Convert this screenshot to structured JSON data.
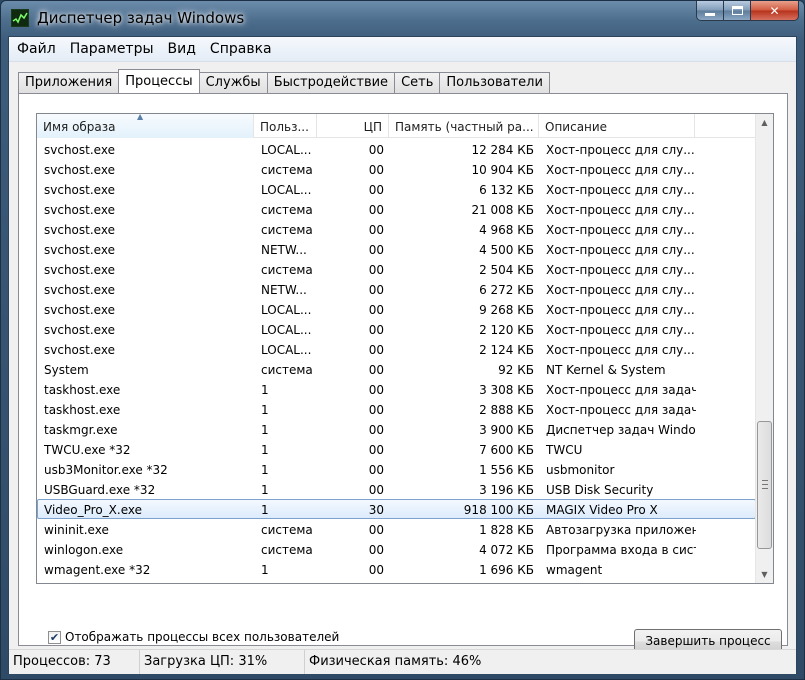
{
  "window": {
    "title": "Диспетчер задач Windows"
  },
  "menu": [
    "Файл",
    "Параметры",
    "Вид",
    "Справка"
  ],
  "tabs": [
    "Приложения",
    "Процессы",
    "Службы",
    "Быстродействие",
    "Сеть",
    "Пользователи"
  ],
  "active_tab": "Процессы",
  "table": {
    "columns": [
      "Имя образа",
      "Польз...",
      "ЦП",
      "Память (частный ра...",
      "Описание"
    ],
    "sorted_column": "Имя образа",
    "rows": [
      [
        "svchost.exe",
        "LOCAL...",
        "00",
        "12 284 КБ",
        "Хост-процесс для слу..."
      ],
      [
        "svchost.exe",
        "система",
        "00",
        "10 904 КБ",
        "Хост-процесс для слу..."
      ],
      [
        "svchost.exe",
        "LOCAL...",
        "00",
        "6 132 КБ",
        "Хост-процесс для слу..."
      ],
      [
        "svchost.exe",
        "система",
        "00",
        "21 008 КБ",
        "Хост-процесс для слу..."
      ],
      [
        "svchost.exe",
        "система",
        "00",
        "4 968 КБ",
        "Хост-процесс для слу..."
      ],
      [
        "svchost.exe",
        "NETW...",
        "00",
        "4 500 КБ",
        "Хост-процесс для слу..."
      ],
      [
        "svchost.exe",
        "система",
        "00",
        "2 504 КБ",
        "Хост-процесс для слу..."
      ],
      [
        "svchost.exe",
        "NETW...",
        "00",
        "6 272 КБ",
        "Хост-процесс для слу..."
      ],
      [
        "svchost.exe",
        "LOCAL...",
        "00",
        "9 268 КБ",
        "Хост-процесс для слу..."
      ],
      [
        "svchost.exe",
        "LOCAL...",
        "00",
        "2 120 КБ",
        "Хост-процесс для слу..."
      ],
      [
        "svchost.exe",
        "LOCAL...",
        "00",
        "2 124 КБ",
        "Хост-процесс для слу..."
      ],
      [
        "System",
        "система",
        "00",
        "92 КБ",
        "NT Kernel & System"
      ],
      [
        "taskhost.exe",
        "1",
        "00",
        "3 308 КБ",
        "Хост-процесс для задач..."
      ],
      [
        "taskhost.exe",
        "1",
        "00",
        "2 888 КБ",
        "Хост-процесс для задач..."
      ],
      [
        "taskmgr.exe",
        "1",
        "00",
        "3 900 КБ",
        "Диспетчер задач Windows"
      ],
      [
        "TWCU.exe *32",
        "1",
        "00",
        "7 600 КБ",
        "TWCU"
      ],
      [
        "usb3Monitor.exe *32",
        "1",
        "00",
        "1 556 КБ",
        "usbmonitor"
      ],
      [
        "USBGuard.exe *32",
        "1",
        "00",
        "3 196 КБ",
        "USB Disk Security"
      ],
      [
        "Video_Pro_X.exe",
        "1",
        "30",
        "918 100 КБ",
        "MAGIX Video Pro X"
      ],
      [
        "wininit.exe",
        "система",
        "00",
        "1 828 КБ",
        "Автозагрузка приложений..."
      ],
      [
        "winlogon.exe",
        "система",
        "00",
        "4 072 КБ",
        "Программа входа в систему..."
      ],
      [
        "wmagent.exe *32",
        "1",
        "00",
        "1 696 КБ",
        "wmagent"
      ]
    ],
    "selected_row": 18
  },
  "show_all": {
    "label": "Отображать процессы всех пользователей",
    "checked": true
  },
  "end_button": "Завершить процесс",
  "status": {
    "processes": "Процессов: 73",
    "cpu": "Загрузка ЦП: 31%",
    "memory": "Физическая память: 46%"
  },
  "icons": {
    "app": "task-manager-icon",
    "minimize": "minimize-icon",
    "maximize": "maximize-icon",
    "close": "close-icon",
    "sort": "sort-ascending-icon",
    "check": "checkmark-icon"
  }
}
